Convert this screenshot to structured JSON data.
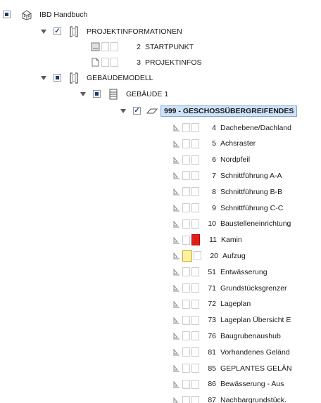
{
  "tree": {
    "root": {
      "label": "IBD Handbuch"
    },
    "projekt": {
      "label": "PROJEKTINFORMATIONEN",
      "children": [
        {
          "num": "2",
          "label": "STARTPUNKT"
        },
        {
          "num": "3",
          "label": "PROJEKTINFOS"
        }
      ]
    },
    "gebaeudemodell": {
      "label": "GEBÄUDEMODELL"
    },
    "gebaeude": {
      "label": "GEBÄUDE 1"
    },
    "geschoss": {
      "label": "999 - GESCHOSSÜBERGREIFENDES"
    },
    "plans": [
      {
        "num": "4",
        "label": "Dachebene/Dachland"
      },
      {
        "num": "5",
        "label": "Achsraster"
      },
      {
        "num": "6",
        "label": "Nordpfeil"
      },
      {
        "num": "7",
        "label": "Schnittführung A-A"
      },
      {
        "num": "8",
        "label": "Schnittführung B-B"
      },
      {
        "num": "9",
        "label": "Schnittführung C-C"
      },
      {
        "num": "10",
        "label": "Baustelleneinrichtung"
      },
      {
        "num": "11",
        "label": "Kamin",
        "marker": "red"
      },
      {
        "num": "20",
        "label": "Aufzug",
        "marker": "yellow"
      },
      {
        "num": "51",
        "label": "Entwässerung"
      },
      {
        "num": "71",
        "label": "Grundstücksgrenzer"
      },
      {
        "num": "72",
        "label": "Lageplan"
      },
      {
        "num": "73",
        "label": "Lageplan Übersicht E"
      },
      {
        "num": "76",
        "label": "Baugrubenaushub"
      },
      {
        "num": "81",
        "label": "Vorhandenes Geländ"
      },
      {
        "num": "85",
        "label": "GEPLANTES GELÄN"
      },
      {
        "num": "86",
        "label": "Bewässerung - Aus"
      },
      {
        "num": "87",
        "label": "Nachbargrundstück."
      }
    ]
  }
}
